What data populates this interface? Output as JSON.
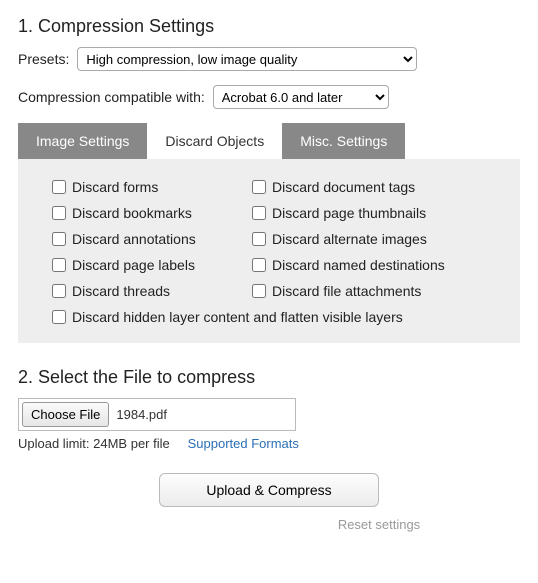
{
  "section1": {
    "title": "1. Compression Settings",
    "presets_label": "Presets:",
    "preset_value": "High compression, low image quality",
    "compat_label": "Compression compatible with:",
    "compat_value": "Acrobat 6.0 and later"
  },
  "tabs": {
    "image_settings": "Image Settings",
    "discard_objects": "Discard Objects",
    "misc_settings": "Misc. Settings"
  },
  "discard_opts": {
    "forms": "Discard forms",
    "doc_tags": "Discard document tags",
    "bookmarks": "Discard bookmarks",
    "thumbnails": "Discard page thumbnails",
    "annotations": "Discard annotations",
    "alt_images": "Discard alternate images",
    "page_labels": "Discard page labels",
    "named_dest": "Discard named destinations",
    "threads": "Discard threads",
    "attachments": "Discard file attachments",
    "hidden_layers": "Discard hidden layer content and flatten visible layers"
  },
  "section2": {
    "title": "2. Select the File to compress",
    "choose_label": "Choose File",
    "file_name": "1984.pdf",
    "limit_text": "Upload limit: 24MB per file",
    "supported_text": "Supported Formats"
  },
  "actions": {
    "upload_label": "Upload & Compress",
    "reset_label": "Reset settings"
  }
}
